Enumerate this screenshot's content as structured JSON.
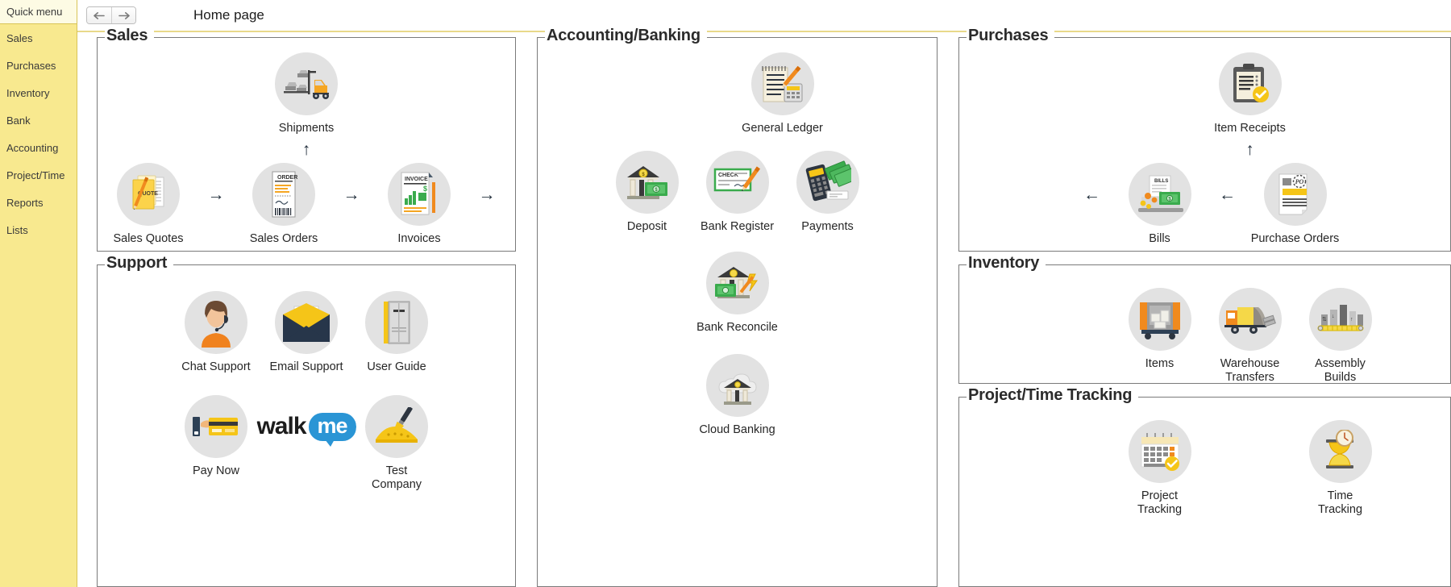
{
  "sidebar": {
    "header": "Quick menu",
    "items": [
      {
        "label": "Sales"
      },
      {
        "label": "Purchases"
      },
      {
        "label": "Inventory"
      },
      {
        "label": "Bank"
      },
      {
        "label": "Accounting"
      },
      {
        "label": "Project/Time"
      },
      {
        "label": "Reports"
      },
      {
        "label": "Lists"
      }
    ]
  },
  "topbar": {
    "back_icon": "arrow-left-icon",
    "forward_icon": "arrow-right-icon",
    "title": "Home page"
  },
  "groups": {
    "sales": {
      "legend": "Sales",
      "tiles": {
        "shipments": "Shipments",
        "sales_quotes": "Sales Quotes",
        "sales_orders": "Sales Orders",
        "invoices": "Invoices"
      },
      "arrows": {
        "up": "↑",
        "right": "→"
      }
    },
    "support": {
      "legend": "Support",
      "tiles": {
        "chat_support": "Chat Support",
        "email_support": "Email Support",
        "user_guide": "User Guide",
        "pay_now": "Pay Now",
        "walkme": "walkme",
        "test_company": "Test\nCompany"
      }
    },
    "accounting": {
      "legend": "Accounting/Banking",
      "tiles": {
        "general_ledger": "General Ledger",
        "deposit": "Deposit",
        "bank_register": "Bank Register",
        "payments": "Payments",
        "bank_reconcile": "Bank Reconcile",
        "cloud_banking": "Cloud Banking"
      }
    },
    "purchases": {
      "legend": "Purchases",
      "tiles": {
        "item_receipts": "Item Receipts",
        "bills": "Bills",
        "purchase_orders": "Purchase Orders"
      },
      "arrows": {
        "up": "↑",
        "left": "←"
      }
    },
    "inventory": {
      "legend": "Inventory",
      "tiles": {
        "items": "Items",
        "warehouse_transfers": "Warehouse\nTransfers",
        "assembly_builds": "Assembly\nBuilds"
      }
    },
    "project_time": {
      "legend": "Project/Time Tracking",
      "tiles": {
        "project_tracking": "Project\nTracking",
        "time_tracking": "Time\nTracking"
      }
    }
  },
  "colors": {
    "sidebar_bg": "#f8e98f",
    "sidebar_header_bg": "#fdfbe4",
    "disc_bg": "#e2e2e2",
    "group_border": "#7a7a7a",
    "accent_yellow": "#f5b800",
    "accent_orange": "#f08a1e",
    "accent_green": "#3aab4d",
    "accent_blue": "#2a95d5",
    "arrow": "#23303d"
  }
}
